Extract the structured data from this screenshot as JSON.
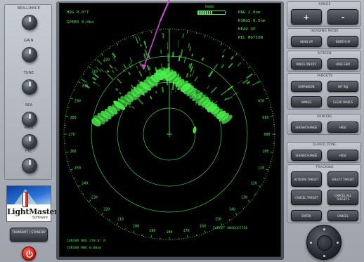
{
  "left_panel": {
    "controls": [
      {
        "label": "BRILLIANCE"
      },
      {
        "label": "GAIN"
      },
      {
        "label": "TUNE"
      },
      {
        "label": "SEA"
      },
      {
        "label": "RAIN"
      },
      {
        "label": "FTC"
      }
    ],
    "logo": {
      "brand": "LightMaster",
      "sub": "Software"
    },
    "transmit_button": "TRANSMIT / STANDBY"
  },
  "screen": {
    "heading": "HDG  0.0°T",
    "speed": "SPEED  0.0kn",
    "range_label": "RANGE",
    "range_value": "RNG 2.0nm",
    "rings_value": "RINGS 0.5nm",
    "orientation": "HEAD UP",
    "motion": "REL MOTION",
    "cursor_bearing": "CURSOR BRG 270.0° R",
    "cursor_range": "CURSOR RNG 0.00nm",
    "target_status": "TARGET UNSELECTED",
    "bearing_labels": [
      "070",
      "080",
      "090",
      "100",
      "110",
      "120",
      "130",
      "140",
      "150",
      "160",
      "170",
      "180",
      "190",
      "200",
      "210",
      "220",
      "230",
      "240",
      "250",
      "260",
      "270",
      "280",
      "290",
      "300",
      "310",
      "320"
    ],
    "range_bar_fill_fraction": 0.55
  },
  "right_panel": {
    "range_group": {
      "title": "RANGE",
      "plus": "+",
      "minus": "-"
    },
    "heading_group": {
      "title": "HEADING MODE",
      "head_up": "HEAD UP",
      "north_up": "NORTH UP"
    },
    "screen_group": {
      "title": "SCREEN",
      "rings": "RINGS ON/OFF",
      "hide_ebm": "HIDE EBM"
    },
    "targets_group": {
      "title": "TARGETS",
      "expansion": "EXPANSION",
      "int_rej": "INT REJ",
      "wakes": "WAKES",
      "clear_wakes": "CLEAR WAKES"
    },
    "vrm_group": {
      "title": "VRM/EBL",
      "show_change": "SHOW/CHANGE",
      "hide": "HIDE"
    },
    "guard_group": {
      "title": "GUARD ZONE",
      "show_change": "SHOW/CHANGE",
      "hide": "HIDE"
    },
    "tracking_group": {
      "title": "TRACKING",
      "acquire": "ACQUIRE TARGET",
      "select": "SELECT TARGET",
      "cancel": "CANCEL TARGET",
      "cancel_all": "CANCEL ALL TARGETS",
      "enter": "ENTER",
      "cancel_btn": "CANCEL"
    }
  },
  "colors": {
    "radar_green": "#4cf04c",
    "pointer": "#d04ad0",
    "power": "#d41c12"
  }
}
